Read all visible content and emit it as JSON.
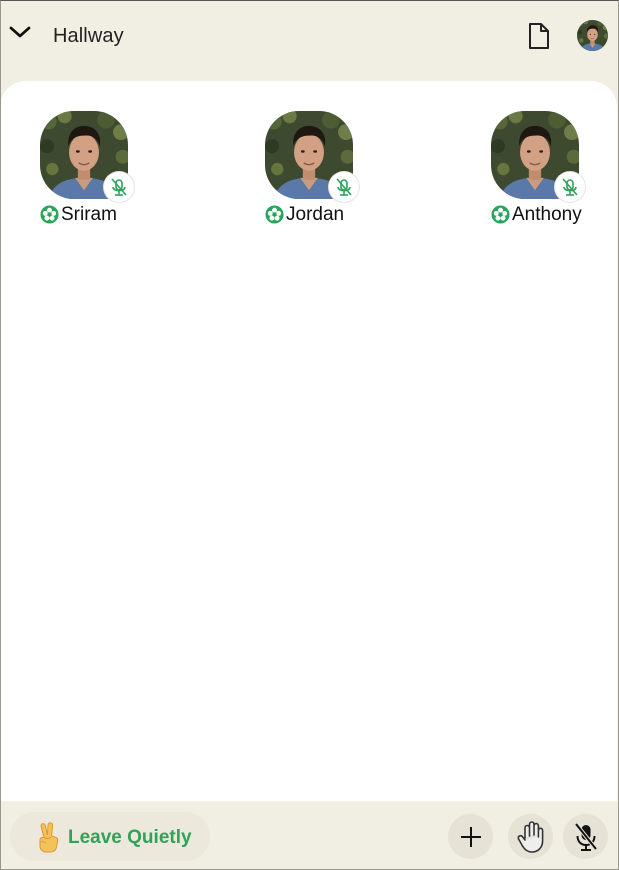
{
  "header": {
    "title": "Hallway",
    "collapse_icon": "chevron-down-icon",
    "notes_icon": "document-icon",
    "user_avatar": "user-avatar"
  },
  "participants": [
    {
      "name": "Sriram",
      "mic": "mic-muted-icon",
      "status": "online-status-icon"
    },
    {
      "name": "Jordan",
      "mic": "mic-muted-icon",
      "status": "online-status-icon"
    },
    {
      "name": "Anthony",
      "mic": "mic-muted-icon",
      "status": "online-status-icon"
    }
  ],
  "footer": {
    "leave_label": "Leave Quietly",
    "leave_icon": "peace-hand-icon",
    "add_icon": "plus-icon",
    "raise_hand_icon": "raise-hand-icon",
    "mute_icon": "mic-muted-icon"
  },
  "colors": {
    "background": "#f1eee3",
    "panel": "#ffffff",
    "accent_green": "#2ea35a",
    "button_bg": "#e6e2d6"
  }
}
